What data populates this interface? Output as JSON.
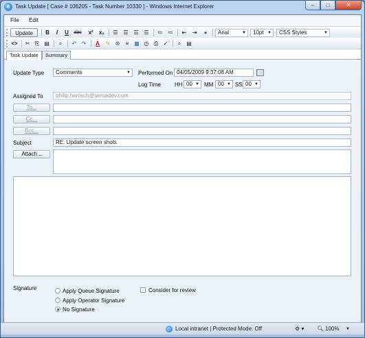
{
  "window": {
    "title": "Task Update [ Case # 106205 - Task Number 10330 ] - Windows Internet Explorer"
  },
  "menu": {
    "file": "File",
    "edit": "Edit"
  },
  "toolbar": {
    "update_label": "Update",
    "font_name": "Arial",
    "font_size": "10pt",
    "css_styles": "CSS Styles",
    "bold": "B",
    "italic": "I",
    "underline": "U",
    "strike": "abc",
    "superscript": "x²",
    "subscript": "x₂",
    "source": "<>"
  },
  "tabs": [
    {
      "label": "Task Update",
      "active": true
    },
    {
      "label": "Summary",
      "active": false
    }
  ],
  "form": {
    "update_type_label": "Update Type",
    "update_type_value": "Comments",
    "performed_on_label": "Performed On",
    "performed_on_value": "04/05/2009 9:37:08 AM",
    "log_time_label": "Log Time",
    "hh_label": "HH",
    "hh_value": "00",
    "mm_label": "MM",
    "mm_value": "00",
    "ss_label": "SS",
    "ss_value": "00",
    "assigned_to_label": "Assigned To",
    "assigned_to_value": "philip.hanisch@versadev.com",
    "to_button": "To...",
    "cc_button": "Cc...",
    "bcc_button": "Bcc...",
    "subject_label": "Subject",
    "subject_value": "RE: Update screen shots",
    "attach_button": "Attach...",
    "signature_label": "Signature",
    "sig_queue": "Apply Queue Signature",
    "sig_operator": "Apply Operator Signature",
    "sig_none": "No Signature",
    "review_label": "Consider for review"
  },
  "status": {
    "zone": "Local intranet | Protected Mode: Off",
    "zoom": "100%"
  },
  "colors": {
    "title_bar": "#bcd3ec",
    "form_bg": "#ebf1f9",
    "accent": "#1466c8"
  }
}
